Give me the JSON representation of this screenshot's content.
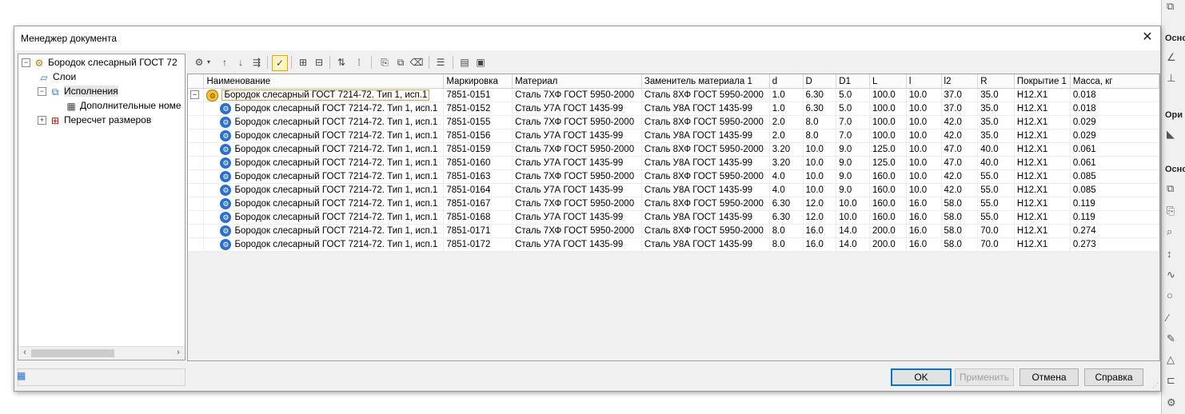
{
  "sidebar_strip": {
    "label_1": "Осно",
    "label_2": "Ори",
    "label_3": "Осно"
  },
  "dialog": {
    "title": "Менеджер документа",
    "close_glyph": "✕"
  },
  "tree": {
    "items": [
      {
        "label": "Бородок слесарный  ГОСТ 72",
        "expander": "−"
      },
      {
        "label": "Слои",
        "expander": ""
      },
      {
        "label": "Исполнения",
        "expander": "−"
      },
      {
        "label": "Дополнительные номе",
        "expander": ""
      },
      {
        "label": "Пересчет размеров",
        "expander": "+"
      }
    ]
  },
  "table": {
    "columns": [
      "Наименование",
      "Маркировка",
      "Материал",
      "Заменитель материала 1",
      "d",
      "D",
      "D1",
      "L",
      "l",
      "l2",
      "R",
      "Покрытие 1",
      "Масса, кг"
    ],
    "rows": [
      [
        "Бородок слесарный  ГОСТ 7214-72.  Тип 1, исп.1",
        "7851-0151",
        "Сталь 7ХФ ГОСТ 5950-2000",
        "Сталь 8ХФ ГОСТ 5950-2000",
        "1.0",
        "6.30",
        "5.0",
        "100.0",
        "10.0",
        "37.0",
        "35.0",
        "H12.X1",
        "0.018"
      ],
      [
        "Бородок слесарный  ГОСТ 7214-72.  Тип 1, исп.1",
        "7851-0152",
        "Сталь У7А ГОСТ 1435-99",
        "Сталь У8А ГОСТ 1435-99",
        "1.0",
        "6.30",
        "5.0",
        "100.0",
        "10.0",
        "37.0",
        "35.0",
        "H12.X1",
        "0.018"
      ],
      [
        "Бородок слесарный  ГОСТ 7214-72.  Тип 1, исп.1",
        "7851-0155",
        "Сталь 7ХФ ГОСТ 5950-2000",
        "Сталь 8ХФ ГОСТ 5950-2000",
        "2.0",
        "8.0",
        "7.0",
        "100.0",
        "10.0",
        "42.0",
        "35.0",
        "H12.X1",
        "0.029"
      ],
      [
        "Бородок слесарный  ГОСТ 7214-72.  Тип 1, исп.1",
        "7851-0156",
        "Сталь У7А ГОСТ 1435-99",
        "Сталь У8А ГОСТ 1435-99",
        "2.0",
        "8.0",
        "7.0",
        "100.0",
        "10.0",
        "42.0",
        "35.0",
        "H12.X1",
        "0.029"
      ],
      [
        "Бородок слесарный  ГОСТ 7214-72.  Тип 1, исп.1",
        "7851-0159",
        "Сталь 7ХФ ГОСТ 5950-2000",
        "Сталь 8ХФ ГОСТ 5950-2000",
        "3.20",
        "10.0",
        "9.0",
        "125.0",
        "10.0",
        "47.0",
        "40.0",
        "H12.X1",
        "0.061"
      ],
      [
        "Бородок слесарный  ГОСТ 7214-72.  Тип 1, исп.1",
        "7851-0160",
        "Сталь У7А ГОСТ 1435-99",
        "Сталь У8А ГОСТ 1435-99",
        "3.20",
        "10.0",
        "9.0",
        "125.0",
        "10.0",
        "47.0",
        "40.0",
        "H12.X1",
        "0.061"
      ],
      [
        "Бородок слесарный  ГОСТ 7214-72.  Тип 1, исп.1",
        "7851-0163",
        "Сталь 7ХФ ГОСТ 5950-2000",
        "Сталь 8ХФ ГОСТ 5950-2000",
        "4.0",
        "10.0",
        "9.0",
        "160.0",
        "10.0",
        "42.0",
        "55.0",
        "H12.X1",
        "0.085"
      ],
      [
        "Бородок слесарный  ГОСТ 7214-72.  Тип 1, исп.1",
        "7851-0164",
        "Сталь У7А ГОСТ 1435-99",
        "Сталь У8А ГОСТ 1435-99",
        "4.0",
        "10.0",
        "9.0",
        "160.0",
        "10.0",
        "42.0",
        "55.0",
        "H12.X1",
        "0.085"
      ],
      [
        "Бородок слесарный  ГОСТ 7214-72.  Тип 1, исп.1",
        "7851-0167",
        "Сталь 7ХФ ГОСТ 5950-2000",
        "Сталь 8ХФ ГОСТ 5950-2000",
        "6.30",
        "12.0",
        "10.0",
        "160.0",
        "16.0",
        "58.0",
        "55.0",
        "H12.X1",
        "0.119"
      ],
      [
        "Бородок слесарный  ГОСТ 7214-72.  Тип 1, исп.1",
        "7851-0168",
        "Сталь У7А ГОСТ 1435-99",
        "Сталь У8А ГОСТ 1435-99",
        "6.30",
        "12.0",
        "10.0",
        "160.0",
        "16.0",
        "58.0",
        "55.0",
        "H12.X1",
        "0.119"
      ],
      [
        "Бородок слесарный  ГОСТ 7214-72.  Тип 1, исп.1",
        "7851-0171",
        "Сталь 7ХФ ГОСТ 5950-2000",
        "Сталь 8ХФ ГОСТ 5950-2000",
        "8.0",
        "16.0",
        "14.0",
        "200.0",
        "16.0",
        "58.0",
        "70.0",
        "H12.X1",
        "0.274"
      ],
      [
        "Бородок слесарный  ГОСТ 7214-72.  Тип 1, исп.1",
        "7851-0172",
        "Сталь У7А ГОСТ 1435-99",
        "Сталь У8А ГОСТ 1435-99",
        "8.0",
        "16.0",
        "14.0",
        "200.0",
        "16.0",
        "58.0",
        "70.0",
        "H12.X1",
        "0.273"
      ]
    ]
  },
  "buttons": {
    "ok": "OK",
    "apply": "Применить",
    "cancel": "Отмена",
    "help": "Справка"
  },
  "colors": {
    "accent": "#0078d7",
    "row_icon": "#2a6fcf",
    "parent_icon": "#f1c232"
  }
}
